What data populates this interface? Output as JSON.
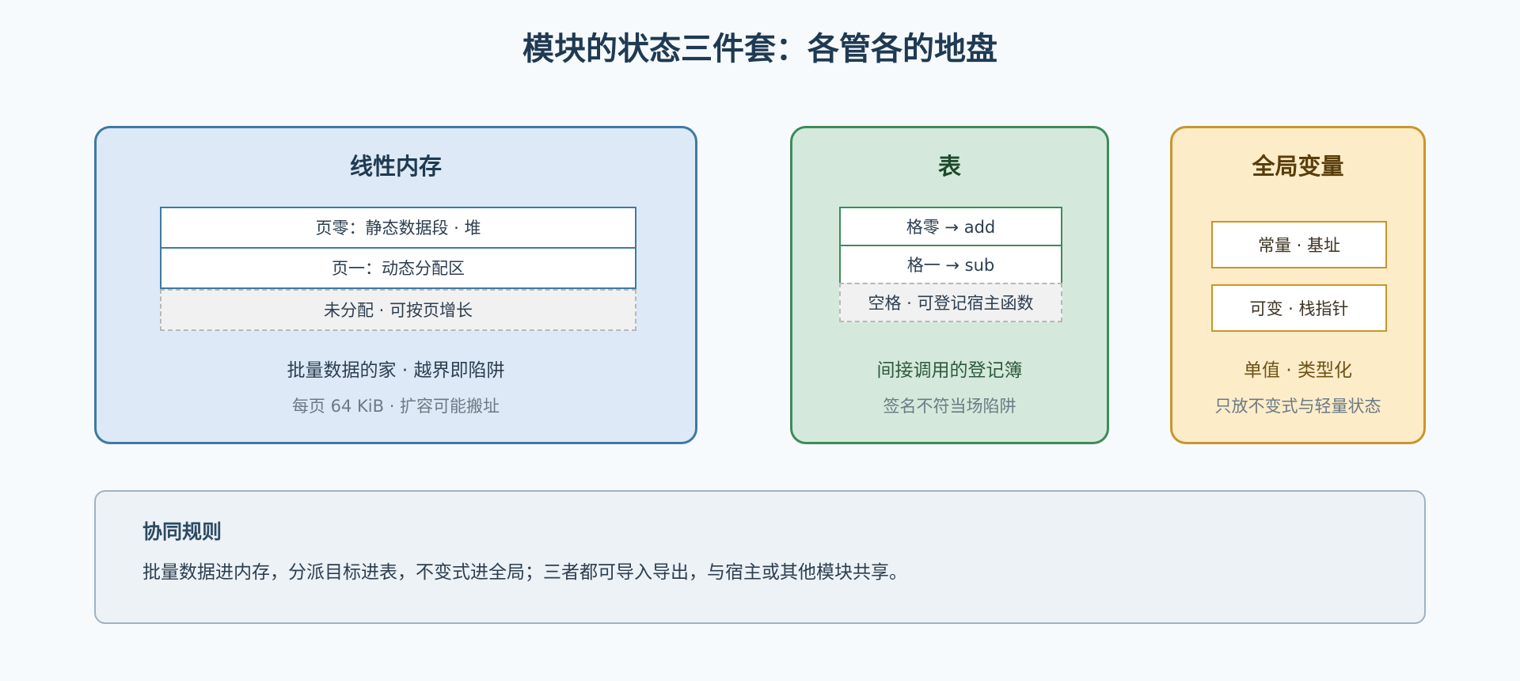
{
  "title": "模块的状态三件套：各管各的地盘",
  "panels": {
    "memory": {
      "heading": "线性内存",
      "cells": [
        "页零：静态数据段 · 堆",
        "页一：动态分配区",
        "未分配 · 可按页增长"
      ],
      "caption": "批量数据的家 · 越界即陷阱",
      "subcaption": "每页 64 KiB · 扩容可能搬址",
      "accent": "#3f79a3",
      "background": "#dde9f6"
    },
    "table": {
      "heading": "表",
      "cells": [
        "格零 → add",
        "格一 → sub",
        "空格 · 可登记宿主函数"
      ],
      "caption": "间接调用的登记簿",
      "subcaption": "签名不符当场陷阱",
      "accent": "#3e8a5a",
      "background": "#d4e9db"
    },
    "globals": {
      "heading": "全局变量",
      "cells": [
        "常量 · 基址",
        "可变 · 栈指针"
      ],
      "caption": "单值 · 类型化",
      "subcaption": "只放不变式与轻量状态",
      "accent": "#c9952c",
      "background": "#fcecc8"
    }
  },
  "rules": {
    "heading": "协同规则",
    "text": "批量数据进内存，分派目标进表，不变式进全局；三者都可导入导出，与宿主或其他模块共享。"
  }
}
